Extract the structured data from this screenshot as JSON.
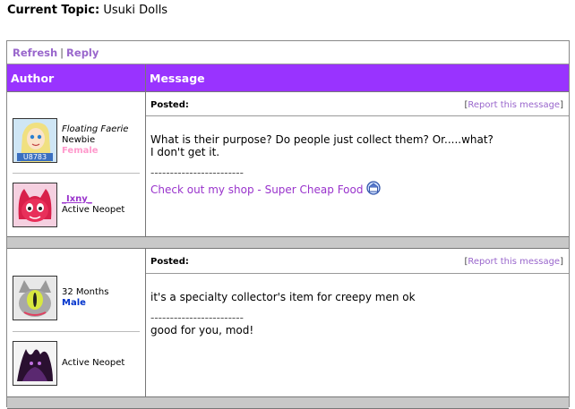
{
  "topic": {
    "label": "Current Topic:",
    "title": "Usuki Dolls"
  },
  "toolbar": {
    "refresh": "Refresh",
    "separator": "|",
    "reply": "Reply"
  },
  "headers": {
    "author": "Author",
    "message": "Message"
  },
  "posts": [
    {
      "author": {
        "title": "Floating Faerie",
        "rank": "Newbie",
        "gender": "Female",
        "avatar_icon": "faerie-avatar-icon",
        "badge": "U8783"
      },
      "user2": {
        "name": "_Ixny_",
        "status": "Active Neopet",
        "avatar_icon": "red-pet-avatar-icon"
      },
      "posted_label": "Posted:",
      "report": {
        "open": "[",
        "label": "Report this message",
        "close": "]"
      },
      "message_lines": [
        "What is their purpose? Do people just collect them? Or.....what?",
        "I don't get it."
      ],
      "sig_separator": "------------------------",
      "sig_link": "Check out my shop - Super Cheap Food"
    },
    {
      "author": {
        "title": "32 Months",
        "gender": "Male",
        "avatar_icon": "cyclops-avatar-icon"
      },
      "user2": {
        "status": "Active Neopet",
        "avatar_icon": "shadow-pet-avatar-icon"
      },
      "posted_label": "Posted:",
      "report": {
        "open": "[",
        "label": "Report this message",
        "close": "]"
      },
      "message_lines": [
        "it's a specialty collector's item for creepy men ok"
      ],
      "sig_separator": "------------------------",
      "sig_text": "good for you, mod!"
    }
  ],
  "colors": {
    "header_bg": "#9933ff",
    "link": "#9966cc",
    "female": "#ff99cc",
    "male": "#0033cc",
    "gap": "#c8c8c8"
  }
}
